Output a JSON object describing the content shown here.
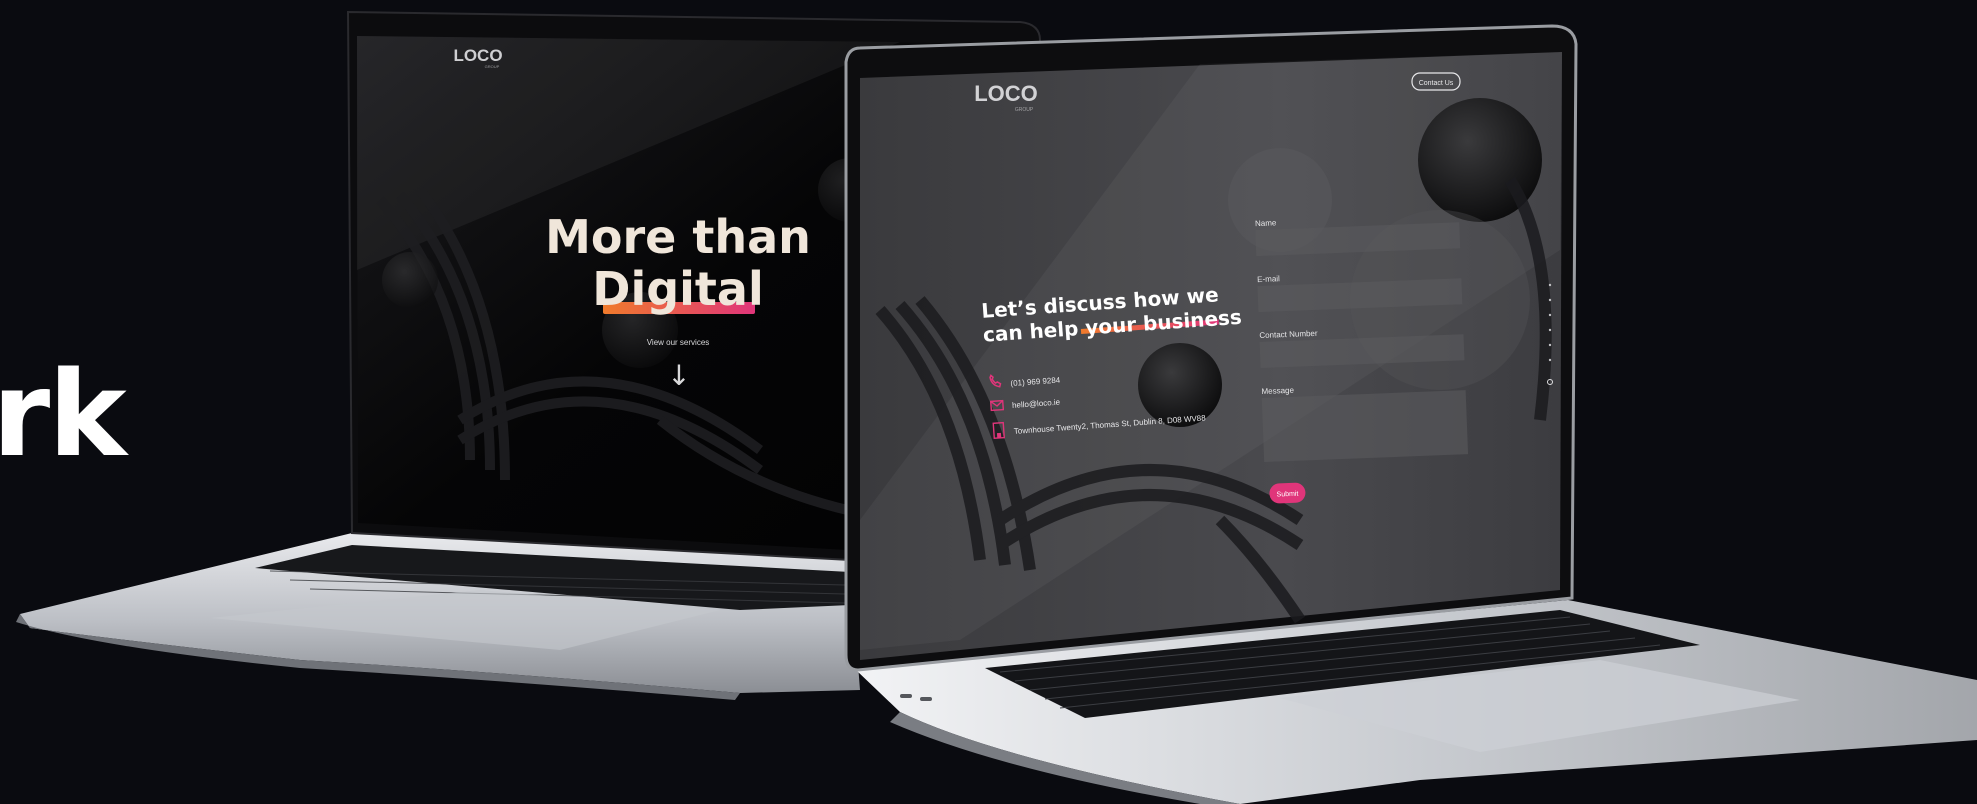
{
  "page": {
    "heading_fragment": "rk",
    "background_color": "#0a0b10",
    "accent_color": "#e0357a"
  },
  "left_laptop": {
    "logo_text": "LOCO",
    "logo_subtext": "GROUP",
    "hero_line1": "More than",
    "hero_line2": "Digital",
    "cta_text": "View our services",
    "arrow": "↓"
  },
  "right_laptop": {
    "logo_text": "LOCO",
    "logo_subtext": "GROUP",
    "contact_button": "Contact Us",
    "headline_line1": "Let’s discuss how we",
    "headline_line2_a": "can help ",
    "headline_line2_b": "your business",
    "phone": "(01) 969 9284",
    "email": "hello@loco.ie",
    "address": "Townhouse Twenty2, Thomas St, Dublin 8, D08 WV88",
    "form": {
      "name_label": "Name",
      "email_label": "E-mail",
      "contact_label": "Contact Number",
      "message_label": "Message",
      "submit_label": "Submit"
    }
  },
  "icons": [
    "phone-icon",
    "mail-icon",
    "building-icon"
  ]
}
